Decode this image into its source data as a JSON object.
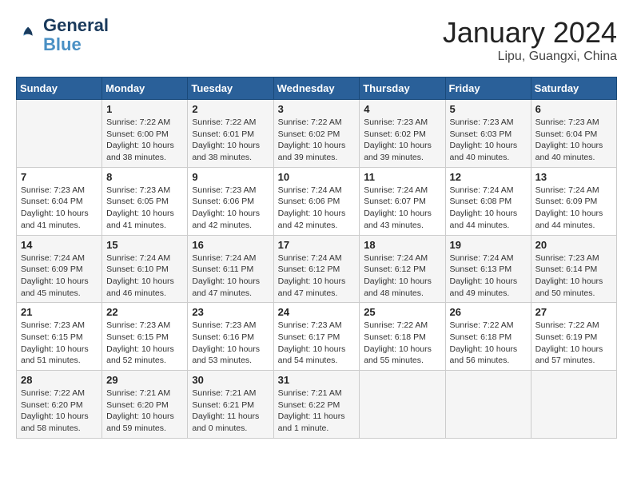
{
  "header": {
    "logo_line1": "General",
    "logo_line2": "Blue",
    "month_title": "January 2024",
    "location": "Lipu, Guangxi, China"
  },
  "days_of_week": [
    "Sunday",
    "Monday",
    "Tuesday",
    "Wednesday",
    "Thursday",
    "Friday",
    "Saturday"
  ],
  "weeks": [
    [
      {
        "day": "",
        "content": ""
      },
      {
        "day": "1",
        "content": "Sunrise: 7:22 AM\nSunset: 6:00 PM\nDaylight: 10 hours\nand 38 minutes."
      },
      {
        "day": "2",
        "content": "Sunrise: 7:22 AM\nSunset: 6:01 PM\nDaylight: 10 hours\nand 38 minutes."
      },
      {
        "day": "3",
        "content": "Sunrise: 7:22 AM\nSunset: 6:02 PM\nDaylight: 10 hours\nand 39 minutes."
      },
      {
        "day": "4",
        "content": "Sunrise: 7:23 AM\nSunset: 6:02 PM\nDaylight: 10 hours\nand 39 minutes."
      },
      {
        "day": "5",
        "content": "Sunrise: 7:23 AM\nSunset: 6:03 PM\nDaylight: 10 hours\nand 40 minutes."
      },
      {
        "day": "6",
        "content": "Sunrise: 7:23 AM\nSunset: 6:04 PM\nDaylight: 10 hours\nand 40 minutes."
      }
    ],
    [
      {
        "day": "7",
        "content": "Sunrise: 7:23 AM\nSunset: 6:04 PM\nDaylight: 10 hours\nand 41 minutes."
      },
      {
        "day": "8",
        "content": "Sunrise: 7:23 AM\nSunset: 6:05 PM\nDaylight: 10 hours\nand 41 minutes."
      },
      {
        "day": "9",
        "content": "Sunrise: 7:23 AM\nSunset: 6:06 PM\nDaylight: 10 hours\nand 42 minutes."
      },
      {
        "day": "10",
        "content": "Sunrise: 7:24 AM\nSunset: 6:06 PM\nDaylight: 10 hours\nand 42 minutes."
      },
      {
        "day": "11",
        "content": "Sunrise: 7:24 AM\nSunset: 6:07 PM\nDaylight: 10 hours\nand 43 minutes."
      },
      {
        "day": "12",
        "content": "Sunrise: 7:24 AM\nSunset: 6:08 PM\nDaylight: 10 hours\nand 44 minutes."
      },
      {
        "day": "13",
        "content": "Sunrise: 7:24 AM\nSunset: 6:09 PM\nDaylight: 10 hours\nand 44 minutes."
      }
    ],
    [
      {
        "day": "14",
        "content": "Sunrise: 7:24 AM\nSunset: 6:09 PM\nDaylight: 10 hours\nand 45 minutes."
      },
      {
        "day": "15",
        "content": "Sunrise: 7:24 AM\nSunset: 6:10 PM\nDaylight: 10 hours\nand 46 minutes."
      },
      {
        "day": "16",
        "content": "Sunrise: 7:24 AM\nSunset: 6:11 PM\nDaylight: 10 hours\nand 47 minutes."
      },
      {
        "day": "17",
        "content": "Sunrise: 7:24 AM\nSunset: 6:12 PM\nDaylight: 10 hours\nand 47 minutes."
      },
      {
        "day": "18",
        "content": "Sunrise: 7:24 AM\nSunset: 6:12 PM\nDaylight: 10 hours\nand 48 minutes."
      },
      {
        "day": "19",
        "content": "Sunrise: 7:24 AM\nSunset: 6:13 PM\nDaylight: 10 hours\nand 49 minutes."
      },
      {
        "day": "20",
        "content": "Sunrise: 7:23 AM\nSunset: 6:14 PM\nDaylight: 10 hours\nand 50 minutes."
      }
    ],
    [
      {
        "day": "21",
        "content": "Sunrise: 7:23 AM\nSunset: 6:15 PM\nDaylight: 10 hours\nand 51 minutes."
      },
      {
        "day": "22",
        "content": "Sunrise: 7:23 AM\nSunset: 6:15 PM\nDaylight: 10 hours\nand 52 minutes."
      },
      {
        "day": "23",
        "content": "Sunrise: 7:23 AM\nSunset: 6:16 PM\nDaylight: 10 hours\nand 53 minutes."
      },
      {
        "day": "24",
        "content": "Sunrise: 7:23 AM\nSunset: 6:17 PM\nDaylight: 10 hours\nand 54 minutes."
      },
      {
        "day": "25",
        "content": "Sunrise: 7:22 AM\nSunset: 6:18 PM\nDaylight: 10 hours\nand 55 minutes."
      },
      {
        "day": "26",
        "content": "Sunrise: 7:22 AM\nSunset: 6:18 PM\nDaylight: 10 hours\nand 56 minutes."
      },
      {
        "day": "27",
        "content": "Sunrise: 7:22 AM\nSunset: 6:19 PM\nDaylight: 10 hours\nand 57 minutes."
      }
    ],
    [
      {
        "day": "28",
        "content": "Sunrise: 7:22 AM\nSunset: 6:20 PM\nDaylight: 10 hours\nand 58 minutes."
      },
      {
        "day": "29",
        "content": "Sunrise: 7:21 AM\nSunset: 6:20 PM\nDaylight: 10 hours\nand 59 minutes."
      },
      {
        "day": "30",
        "content": "Sunrise: 7:21 AM\nSunset: 6:21 PM\nDaylight: 11 hours\nand 0 minutes."
      },
      {
        "day": "31",
        "content": "Sunrise: 7:21 AM\nSunset: 6:22 PM\nDaylight: 11 hours\nand 1 minute."
      },
      {
        "day": "",
        "content": ""
      },
      {
        "day": "",
        "content": ""
      },
      {
        "day": "",
        "content": ""
      }
    ]
  ]
}
